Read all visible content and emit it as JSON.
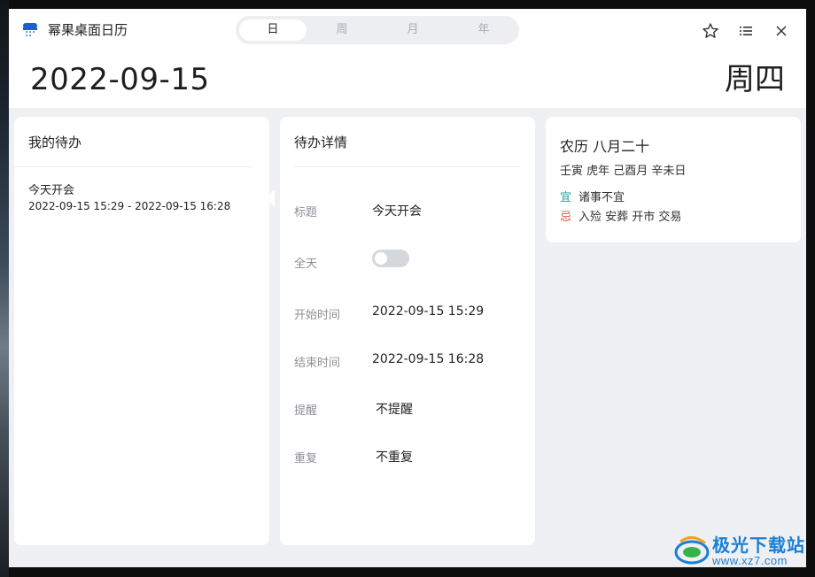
{
  "app": {
    "title": "幂果桌面日历",
    "view_tabs": [
      "日",
      "周",
      "月",
      "年"
    ],
    "active_tab_index": 0
  },
  "header": {
    "date": "2022-09-15",
    "weekday": "周四"
  },
  "todo_panel": {
    "heading": "我的待办",
    "items": [
      {
        "title": "今天开会",
        "time_range": "2022-09-15 15:29 - 2022-09-15 16:28"
      }
    ]
  },
  "detail_panel": {
    "heading": "待办详情",
    "fields": {
      "title_label": "标题",
      "title_value": "今天开会",
      "allday_label": "全天",
      "allday_on": false,
      "start_label": "开始时间",
      "start_value": "2022-09-15 15:29",
      "end_label": "结束时间",
      "end_value": "2022-09-15 16:28",
      "remind_label": "提醒",
      "remind_value": "不提醒",
      "repeat_label": "重复",
      "repeat_value": "不重复"
    }
  },
  "lunar_panel": {
    "lunar_date": "农历 八月二十",
    "ganzhi": "壬寅 虎年 己酉月 辛未日",
    "yi_label": "宜",
    "yi_text": "诸事不宜",
    "ji_label": "忌",
    "ji_text": "入殓 安葬 开市 交易"
  },
  "icons": {
    "app": "calendar-app-icon",
    "star": "star-outline-icon",
    "menu": "list-menu-icon",
    "close": "close-icon"
  },
  "colors": {
    "yi": "#1aa39a",
    "ji": "#e2534b",
    "watermark": "#1a7fd4"
  },
  "watermark": {
    "brand": "极光下载站",
    "url": "www.xz7.com"
  }
}
